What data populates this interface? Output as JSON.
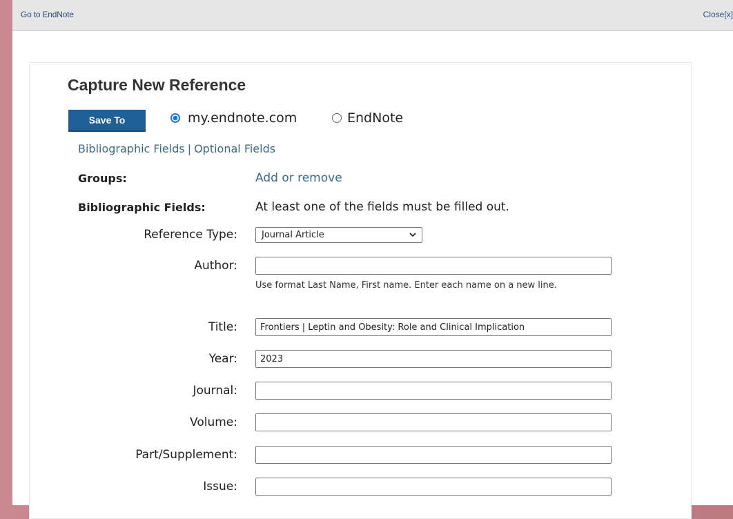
{
  "topbar": {
    "goto_label": "Go to EndNote",
    "close_label": "Close[x]"
  },
  "form": {
    "title": "Capture New Reference",
    "save_button": "Save To",
    "save_options": [
      {
        "label": "my.endnote.com",
        "selected": true
      },
      {
        "label": "EndNote",
        "selected": false
      }
    ],
    "field_links": {
      "bibliographic": "Bibliographic Fields",
      "separator": "|",
      "optional": "Optional Fields"
    },
    "groups": {
      "label": "Groups:",
      "action": "Add or remove"
    },
    "bibliographic": {
      "label": "Bibliographic Fields:",
      "note": "At least one of the fields must be filled out."
    },
    "reference_type": {
      "label": "Reference Type:",
      "value": "Journal Article"
    },
    "author": {
      "label": "Author:",
      "value": "",
      "help": "Use format Last Name, First name. Enter each name on a new line."
    },
    "title_field": {
      "label": "Title:",
      "value": "Frontiers | Leptin and Obesity: Role and Clinical Implication"
    },
    "year": {
      "label": "Year:",
      "value": "2023"
    },
    "journal": {
      "label": "Journal:",
      "value": ""
    },
    "volume": {
      "label": "Volume:",
      "value": ""
    },
    "part_supplement": {
      "label": "Part/Supplement:",
      "value": ""
    },
    "issue": {
      "label": "Issue:",
      "value": ""
    }
  },
  "colors": {
    "save_button_bg": "#1f5f95",
    "link": "#3a6c8a",
    "radio_selected": "#1a73e8"
  }
}
